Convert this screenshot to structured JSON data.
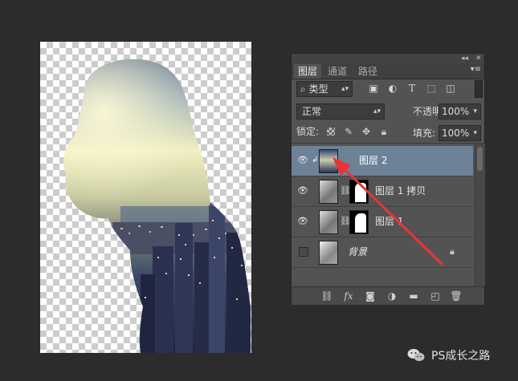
{
  "panel": {
    "tabs": [
      "图层",
      "通道",
      "路径"
    ],
    "active_tab": "图层",
    "filter_kind": "类型",
    "filter_icons": [
      "image-filter-icon",
      "adjustment-filter-icon",
      "type-filter-icon",
      "shape-filter-icon",
      "smart-object-filter-icon"
    ],
    "blend_mode": "正常",
    "opacity_label": "不透明度:",
    "opacity_value": "100%",
    "lock_label": "锁定:",
    "fill_label": "填充:",
    "fill_value": "100%",
    "layers": [
      {
        "name": "图层 2",
        "selected": true,
        "visible": true,
        "clipped": true
      },
      {
        "name": "图层 1 拷贝",
        "selected": false,
        "visible": true,
        "mask": true
      },
      {
        "name": "图层 1",
        "selected": false,
        "visible": true,
        "mask": true
      },
      {
        "name": "背景",
        "selected": false,
        "visible": false,
        "locked": true
      }
    ],
    "bottom_icons": [
      "link-icon",
      "fx-icon",
      "mask-icon",
      "adjustment-icon",
      "group-icon",
      "new-layer-icon",
      "trash-icon"
    ],
    "fx_label": "fx"
  },
  "annotation": {
    "color": "#e8353a"
  },
  "watermark": {
    "text": "PS成长之路"
  },
  "colors": {
    "selected_layer": "#6d8197",
    "panel_bg": "#535353",
    "app_bg": "#2c2c2c"
  }
}
